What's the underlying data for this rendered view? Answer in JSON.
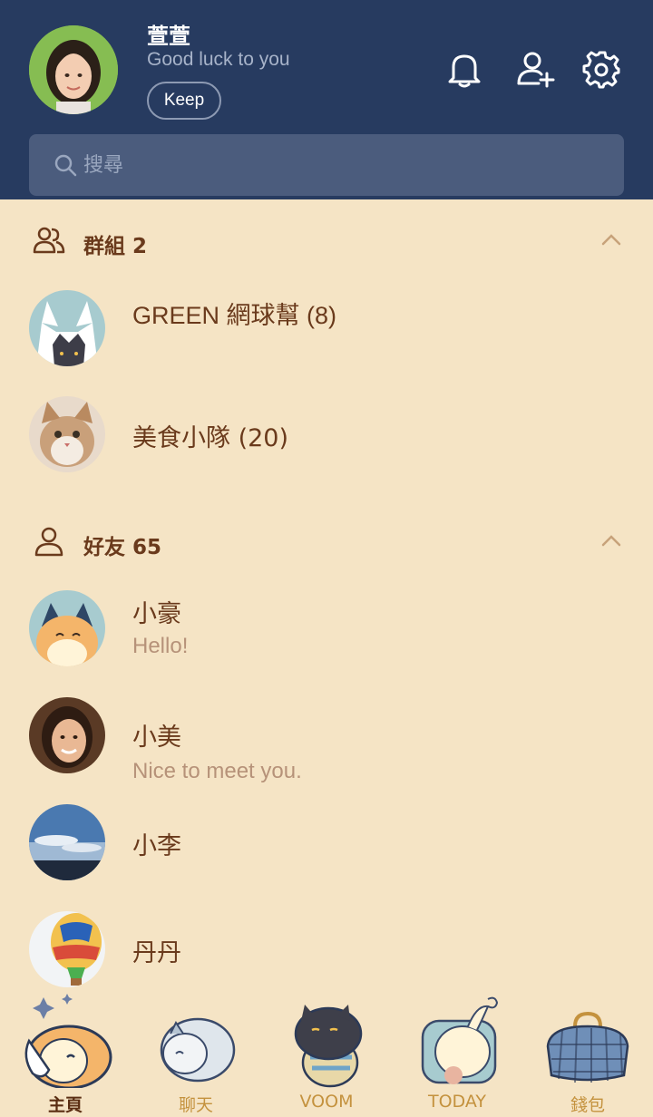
{
  "profile": {
    "name": "萱萱",
    "status": "Good luck to you",
    "keep_label": "Keep"
  },
  "search": {
    "placeholder": "搜尋"
  },
  "sections": {
    "groups": {
      "title": "群組 2",
      "items": [
        {
          "name": "GREEN 網球幫 (8)"
        },
        {
          "name": "美食小隊 (20)"
        }
      ]
    },
    "friends": {
      "title": "好友 65",
      "items": [
        {
          "name": "小豪",
          "message": "Hello!"
        },
        {
          "name": "小美",
          "message": "Nice to meet you."
        },
        {
          "name": "小李"
        },
        {
          "name": "丹丹"
        }
      ]
    }
  },
  "nav": {
    "items": [
      {
        "label": "主頁",
        "active": true
      },
      {
        "label": "聊天"
      },
      {
        "label": "VOOM"
      },
      {
        "label": "TODAY"
      },
      {
        "label": "錢包"
      }
    ]
  },
  "colors": {
    "header_bg": "#273b60",
    "page_bg": "#f5e4c5",
    "text_brown": "#6a3a1c",
    "muted_brown": "#b69279",
    "nav_gold": "#c4923e"
  },
  "icons": [
    "bell-icon",
    "add-friend-icon",
    "gear-icon",
    "search-icon",
    "group-icon",
    "friend-icon",
    "chevron-up-icon"
  ]
}
